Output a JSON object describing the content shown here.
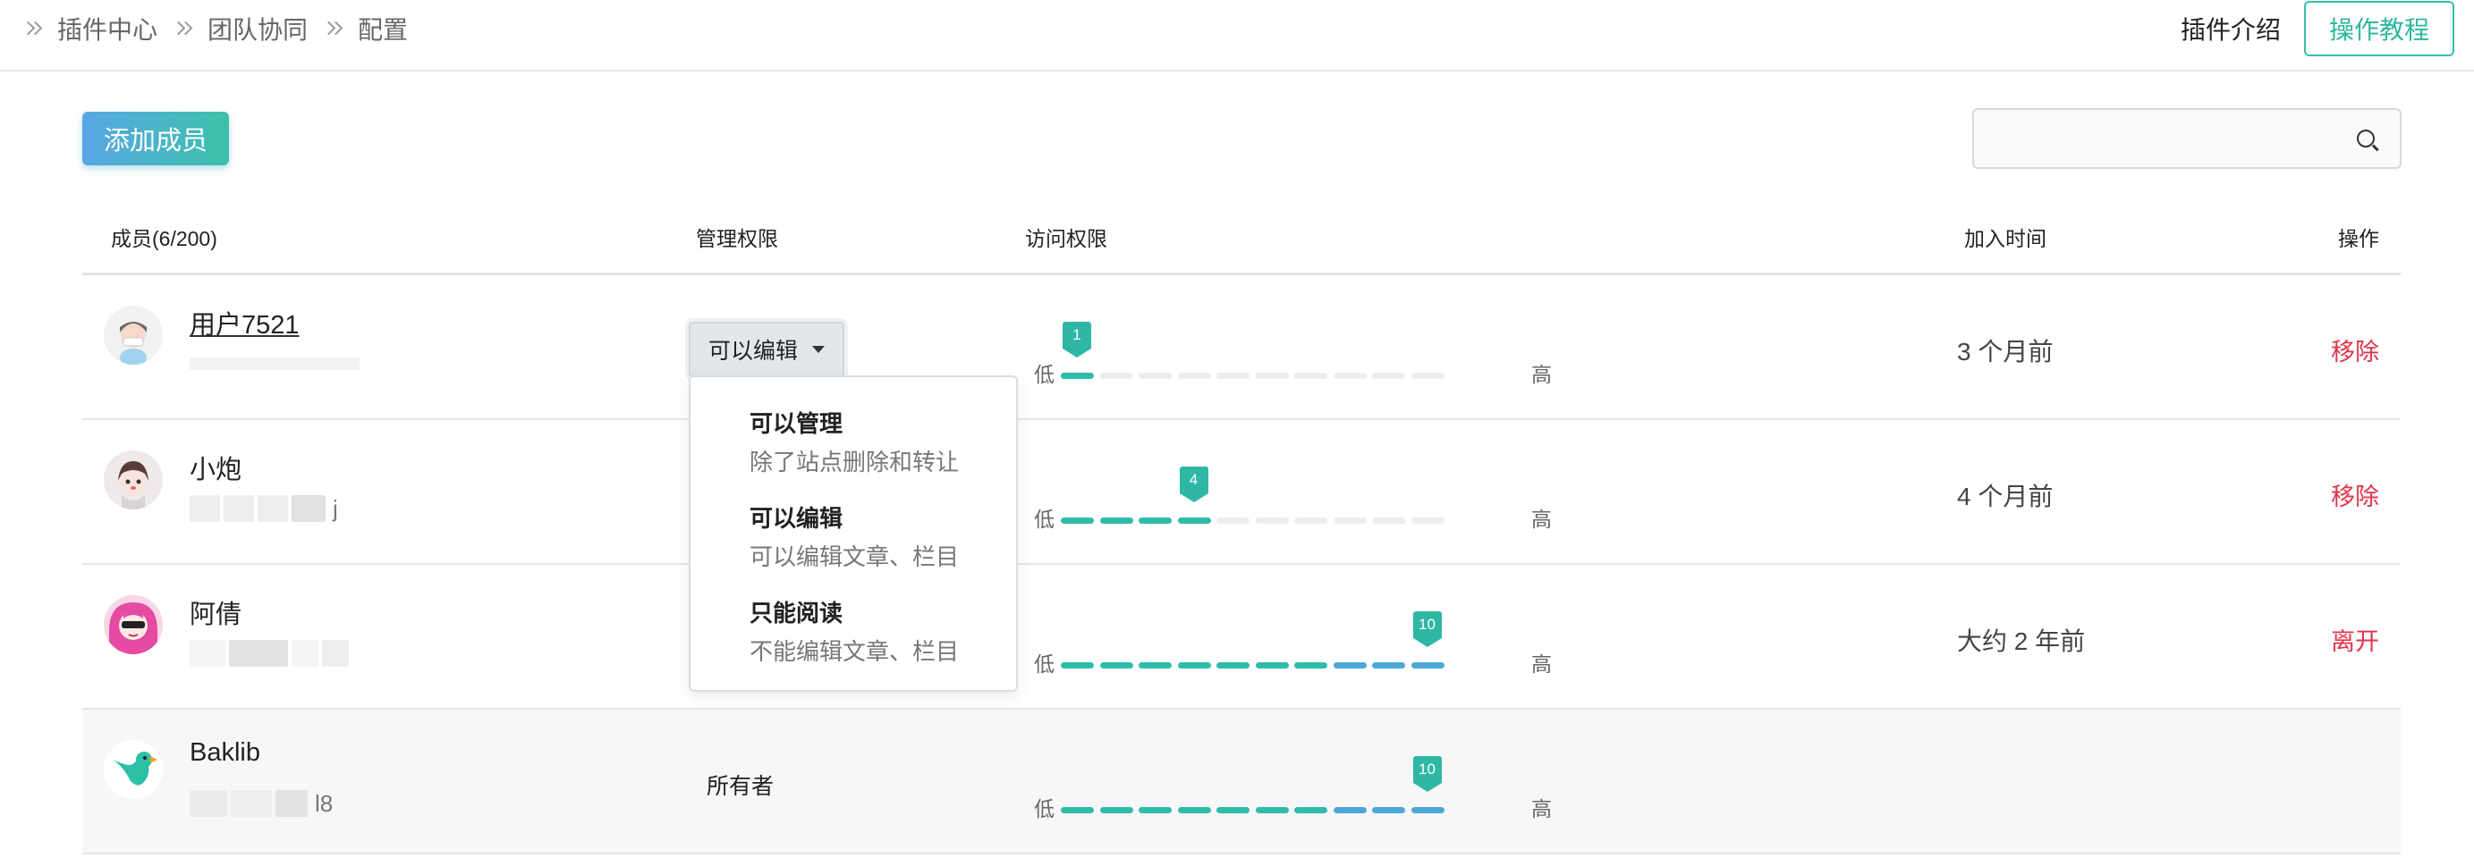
{
  "breadcrumb": [
    "插件中心",
    "团队协同",
    "配置"
  ],
  "header": {
    "intro_label": "插件介绍",
    "tutorial_label": "操作教程"
  },
  "toolbar": {
    "add_member_label": "添加成员",
    "search_placeholder": ""
  },
  "table": {
    "headers": {
      "member": "成员(6/200)",
      "manage": "管理权限",
      "access": "访问权限",
      "joined": "加入时间",
      "action": "操作"
    },
    "level_low_label": "低",
    "level_high_label": "高",
    "rows": [
      {
        "name": "用户7521",
        "sub_tail": "",
        "permission": "可以编辑",
        "permission_dropdown": true,
        "access_level": 1,
        "access_level_text": "1",
        "joined": "3 个月前",
        "action": "移除",
        "avatar_icon": "cartoon-avatar-icon"
      },
      {
        "name": "小炮",
        "sub_tail": "j",
        "permission": "",
        "permission_dropdown": false,
        "access_level": 4,
        "access_level_text": "4",
        "joined": "4 个月前",
        "action": "移除",
        "avatar_icon": "anime-girl-avatar-icon"
      },
      {
        "name": "阿倩",
        "sub_tail": "",
        "permission": "",
        "permission_dropdown": false,
        "access_level": 10,
        "access_level_text": "10",
        "joined": "大约 2 年前",
        "action": "离开",
        "avatar_icon": "pink-hair-avatar-icon"
      },
      {
        "name": "Baklib",
        "sub_tail": "l8",
        "permission": "所有者",
        "permission_dropdown": false,
        "access_level": 10,
        "access_level_text": "10",
        "joined": "",
        "action": "",
        "avatar_icon": "parrot-logo-icon"
      }
    ]
  },
  "permission_menu": {
    "options": [
      {
        "title": "可以管理",
        "desc": "除了站点删除和转让"
      },
      {
        "title": "可以编辑",
        "desc": "可以编辑文章、栏目"
      },
      {
        "title": "只能阅读",
        "desc": "不能编辑文章、栏目"
      }
    ]
  },
  "colors": {
    "accent": "#2fb7a5",
    "danger": "#e0344b",
    "gradient_start": "#58a7e4",
    "gradient_end": "#3cc1aa"
  }
}
